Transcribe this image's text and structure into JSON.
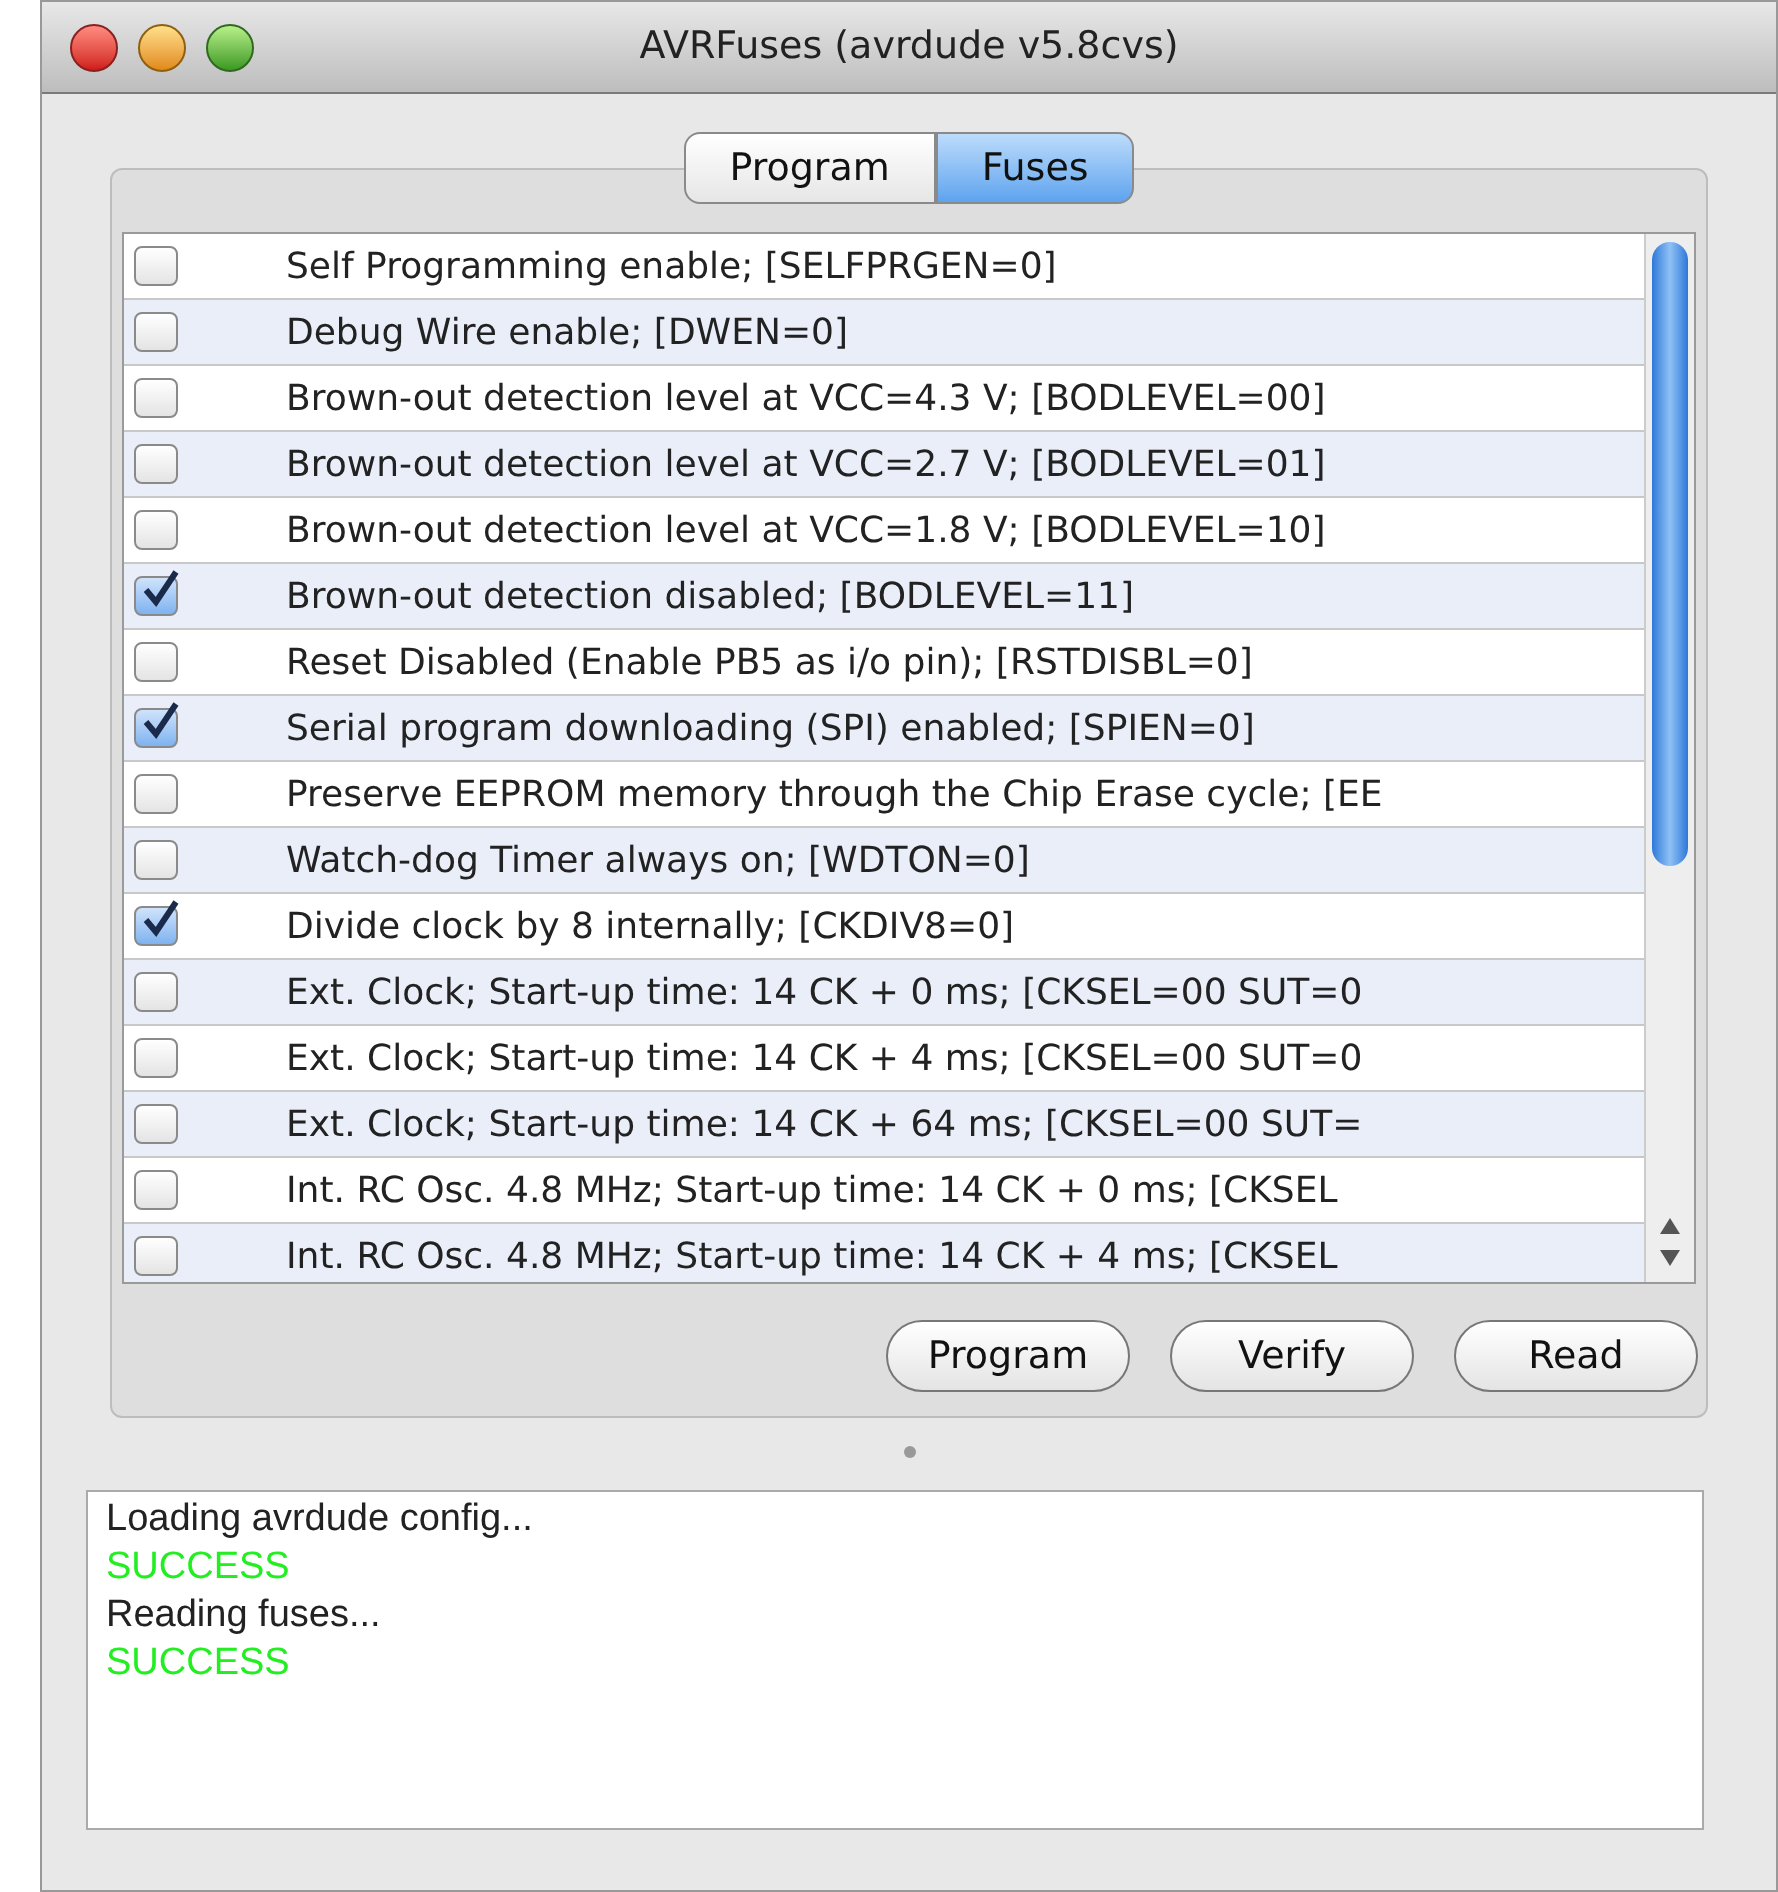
{
  "window": {
    "title": "AVRFuses (avrdude v5.8cvs)"
  },
  "tabs": [
    {
      "label": "Program",
      "selected": false
    },
    {
      "label": "Fuses",
      "selected": true
    }
  ],
  "fuses": [
    {
      "label": "Self Programming enable; [SELFPRGEN=0]",
      "checked": false
    },
    {
      "label": "Debug Wire enable; [DWEN=0]",
      "checked": false
    },
    {
      "label": "Brown-out detection level at VCC=4.3 V; [BODLEVEL=00]",
      "checked": false
    },
    {
      "label": "Brown-out detection level at VCC=2.7 V; [BODLEVEL=01]",
      "checked": false
    },
    {
      "label": "Brown-out detection level at VCC=1.8 V; [BODLEVEL=10]",
      "checked": false
    },
    {
      "label": "Brown-out detection disabled; [BODLEVEL=11]",
      "checked": true
    },
    {
      "label": "Reset Disabled (Enable PB5 as i/o pin); [RSTDISBL=0]",
      "checked": false
    },
    {
      "label": "Serial program downloading (SPI) enabled; [SPIEN=0]",
      "checked": true
    },
    {
      "label": "Preserve EEPROM memory through the Chip Erase cycle; [EE",
      "checked": false
    },
    {
      "label": "Watch-dog Timer always on; [WDTON=0]",
      "checked": false
    },
    {
      "label": "Divide clock by 8 internally; [CKDIV8=0]",
      "checked": true
    },
    {
      "label": "Ext. Clock; Start-up time: 14 CK + 0 ms; [CKSEL=00 SUT=0",
      "checked": false
    },
    {
      "label": "Ext. Clock; Start-up time: 14 CK + 4 ms; [CKSEL=00 SUT=0",
      "checked": false
    },
    {
      "label": "Ext. Clock; Start-up time: 14 CK + 64 ms; [CKSEL=00 SUT=",
      "checked": false
    },
    {
      "label": "Int. RC Osc. 4.8 MHz; Start-up time: 14 CK + 0 ms; [CKSEL",
      "checked": false
    },
    {
      "label": "Int. RC Osc. 4.8 MHz; Start-up time: 14 CK + 4 ms; [CKSEL",
      "checked": false
    }
  ],
  "buttons": [
    "Program",
    "Verify",
    "Read"
  ],
  "log": [
    {
      "text": "Loading avrdude config...",
      "kind": "info"
    },
    {
      "text": "SUCCESS",
      "kind": "success"
    },
    {
      "text": "Reading fuses...",
      "kind": "info"
    },
    {
      "text": "SUCCESS",
      "kind": "success"
    }
  ]
}
